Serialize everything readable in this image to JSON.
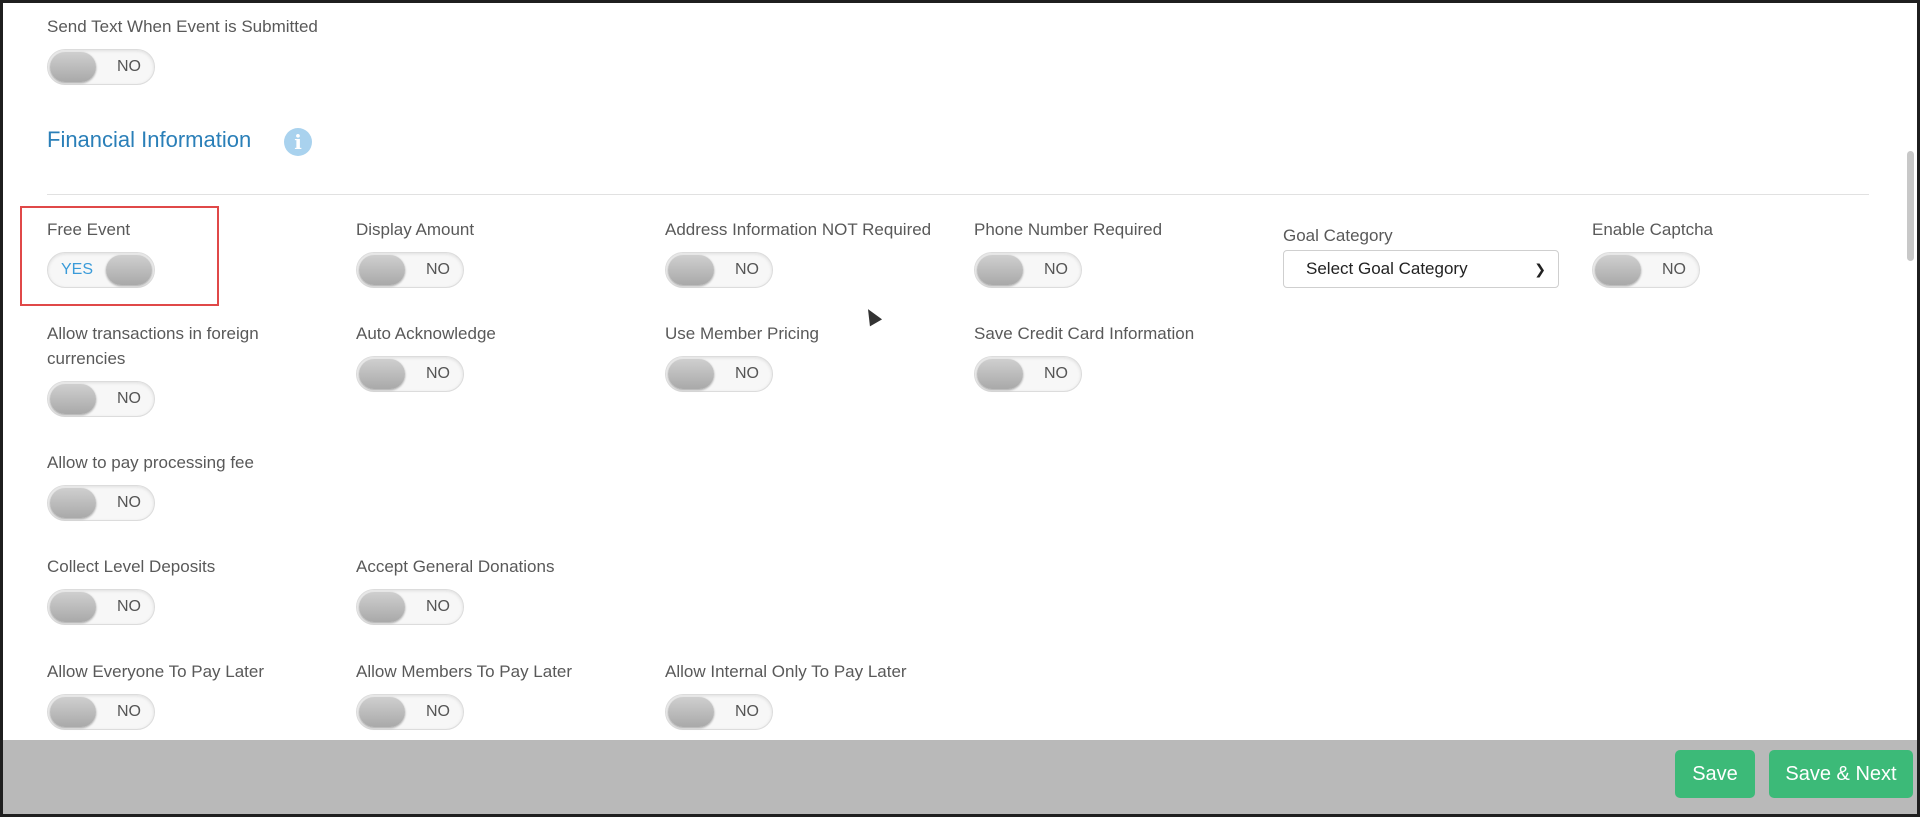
{
  "notifications": {
    "send_text": {
      "label": "Send Text When Event is Submitted",
      "state": "NO"
    }
  },
  "financial": {
    "title": "Financial Information",
    "info_icon": "info-icon",
    "fields": {
      "free_event": {
        "label": "Free Event",
        "state": "YES"
      },
      "display_amount": {
        "label": "Display Amount",
        "state": "NO"
      },
      "address_not_required": {
        "label": "Address Information NOT Required",
        "state": "NO"
      },
      "phone_required": {
        "label": "Phone Number Required",
        "state": "NO"
      },
      "goal_category": {
        "label": "Goal Category",
        "value": "Select Goal Category"
      },
      "enable_captcha": {
        "label": "Enable Captcha",
        "state": "NO"
      },
      "foreign_currencies": {
        "label": "Allow transactions in foreign currencies",
        "state": "NO"
      },
      "auto_acknowledge": {
        "label": "Auto Acknowledge",
        "state": "NO"
      },
      "member_pricing": {
        "label": "Use Member Pricing",
        "state": "NO"
      },
      "save_credit_card": {
        "label": "Save Credit Card Information",
        "state": "NO"
      },
      "processing_fee": {
        "label": "Allow to pay processing fee",
        "state": "NO"
      },
      "level_deposits": {
        "label": "Collect Level Deposits",
        "state": "NO"
      },
      "general_donations": {
        "label": "Accept General Donations",
        "state": "NO"
      },
      "everyone_pay_later": {
        "label": "Allow Everyone To Pay Later",
        "state": "NO"
      },
      "members_pay_later": {
        "label": "Allow Members To Pay Later",
        "state": "NO"
      },
      "internal_pay_later": {
        "label": "Allow Internal Only To Pay Later",
        "state": "NO"
      }
    }
  },
  "footer": {
    "save": "Save",
    "save_next": "Save & Next"
  },
  "colors": {
    "section_title": "#2a7fb8",
    "toggle_on_text": "#3a9bd9",
    "highlight_border": "#e04848",
    "button_green": "#3cba78",
    "footer_bg": "#b9b9b9"
  }
}
